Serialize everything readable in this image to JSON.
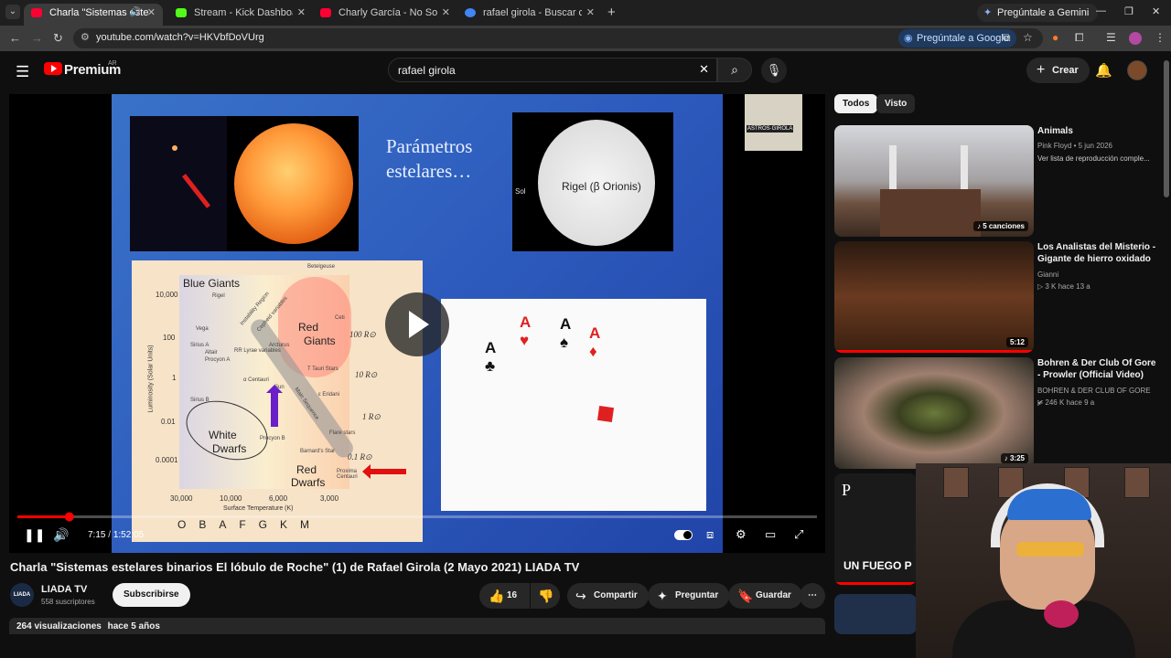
{
  "browser": {
    "tabs": [
      {
        "label": "Charla \"Sistemas estelares b",
        "color": "#ff0033",
        "active": true
      },
      {
        "label": "Stream - Kick Dashboard",
        "color": "#53fc18",
        "active": false
      },
      {
        "label": "Charly García - No Soy Un Extr",
        "color": "#ff0033",
        "active": false
      },
      {
        "label": "rafael girola - Buscar con Goog",
        "color": "#4285f4",
        "active": false
      }
    ],
    "gemini_label": "Pregúntale a Gemini",
    "url": "youtube.com/watch?v=HKVbfDoVUrg",
    "ask_google_label": "Pregúntale a Google"
  },
  "youtube": {
    "logo_text": "Premium",
    "region": "AR",
    "search_value": "rafael girola",
    "create_label": "Crear"
  },
  "slide": {
    "title_line1": "Parámetros",
    "title_line2": "estelares…",
    "rigel_label": "Rigel (β Orionis)",
    "sol_label": "Sol",
    "hr": {
      "y_ticks": [
        "10,000",
        "100",
        "1",
        "0.01",
        "0.0001"
      ],
      "x_ticks": [
        "30,000",
        "10,000",
        "6,000",
        "3,000"
      ],
      "y_label": "Luminosity (Solar Units)",
      "x_label": "Surface Temperature (K)",
      "spectral": "OBAFGKM",
      "blue_giants": "Blue Giants",
      "red_giants_1": "Red",
      "red_giants_2": "Giants",
      "white_dwarfs_1": "White",
      "white_dwarfs_2": "Dwarfs",
      "red_dwarfs_1": "Red",
      "red_dwarfs_2": "Dwarfs",
      "radii": [
        "100 R⊙",
        "10 R⊙",
        "1 R⊙",
        "0.1 R⊙"
      ],
      "small_labels": [
        "Rigel",
        "Betelgeuse",
        "Vega",
        "Sirius A",
        "Altair",
        "Procyon A",
        "Arcturus",
        "Ceti",
        "α Centauri",
        "T Tauri Stars",
        "Sun",
        "Sirius B",
        "ε Eridani",
        "Procyon B",
        "Flare stars",
        "Barnard's Star",
        "Proxima Centauri",
        "Instability Region",
        "Cepheid variables",
        "RR Lyrae variables",
        "Main Sequence"
      ]
    }
  },
  "player": {
    "current_time": "7:15",
    "duration": "1:52:05",
    "progress_fraction": 0.065,
    "mini_sign": "ASTROS·GIROLA"
  },
  "video": {
    "title": "Charla \"Sistemas estelares binarios El lóbulo de Roche\" (1) de Rafael Girola (2 Mayo 2021) LIADA TV",
    "channel": "LIADA TV",
    "channel_avatar_text": "LIADA",
    "subscribers": "558 suscriptores",
    "subscribe_label": "Subscribirse",
    "likes": "16",
    "share_label": "Compartir",
    "ask_label": "Preguntar",
    "save_label": "Guardar",
    "views": "264 visualizaciones",
    "age": "hace 5 años"
  },
  "sidebar": {
    "chips": [
      "Todos",
      "Visto"
    ],
    "items": [
      {
        "title": "Animals",
        "channel": "Pink Floyd",
        "meta": "• 5 jun 2026",
        "extra": "Ver lista de reproducción comple...",
        "badge": "5 canciones"
      },
      {
        "title": "Los Analistas del Misterio - Gigante de hierro oxidado",
        "channel": "Gianni",
        "meta": "3 K  hace 13 a",
        "extra": "",
        "badge": "5:12"
      },
      {
        "title": "Bohren & Der Club Of Gore - Prowler (Official Video)",
        "channel": "BOHREN & DER CLUB OF GORE",
        "meta": "246 K  hace 9 a",
        "extra": "",
        "badge": "3:25"
      }
    ],
    "partial_text": "UN FUEGO P",
    "partial_logo": "P"
  },
  "colors": {
    "accent": "#ff0000",
    "background": "#0f0f0f",
    "chip_bg": "#272727"
  }
}
